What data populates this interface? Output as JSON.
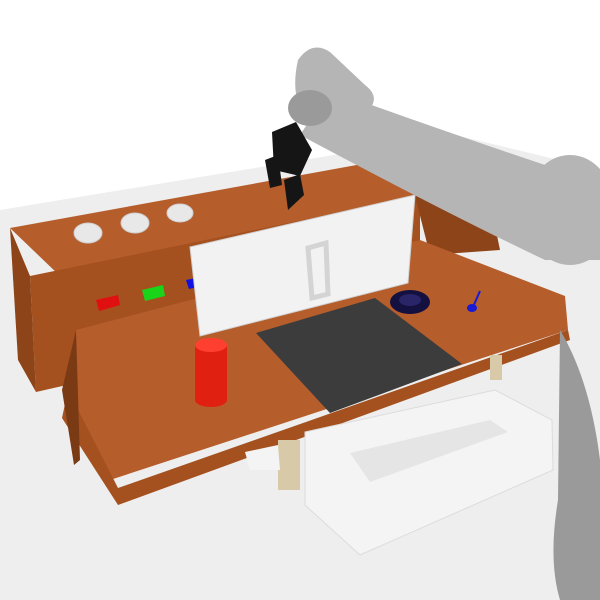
{
  "scene": {
    "colors": {
      "background": "#ffffff",
      "floor": "#eeeeee",
      "wood_top": "#b65d2c",
      "wood_front": "#a4511f",
      "wood_side": "#8e4419",
      "wood_dark": "#7a3a14",
      "panel": "#f2f2f2",
      "panel_edge": "#d6d6d6",
      "mat": "#3c3c3c",
      "robot_light": "#b5b5b5",
      "robot_mid": "#9a9a9a",
      "robot_dark": "#7d7d7d",
      "gripper": "#151515",
      "cylinder_red": "#e02010",
      "button_red": "#e01010",
      "button_green": "#19d419",
      "button_blue": "#1010e0",
      "spoon_blue": "#1a1ad6",
      "bowl_navy": "#141040",
      "leg": "#d8c9a8",
      "bin": "#f4f4f4"
    },
    "objects": [
      {
        "name": "dome-button-left",
        "icon": "dome-icon"
      },
      {
        "name": "dome-button-center",
        "icon": "dome-icon"
      },
      {
        "name": "dome-button-right",
        "icon": "dome-icon"
      },
      {
        "name": "push-button-red",
        "icon": "square-button-icon"
      },
      {
        "name": "push-button-green",
        "icon": "square-button-icon"
      },
      {
        "name": "push-button-blue",
        "icon": "square-button-icon"
      },
      {
        "name": "red-cylinder",
        "icon": "cylinder-icon"
      },
      {
        "name": "navy-bowl",
        "icon": "bowl-icon"
      },
      {
        "name": "blue-spoon",
        "icon": "spoon-icon"
      },
      {
        "name": "robot-arm",
        "icon": "robot-arm-icon"
      },
      {
        "name": "gripper",
        "icon": "gripper-icon"
      },
      {
        "name": "white-bin",
        "icon": "bin-icon"
      }
    ]
  }
}
